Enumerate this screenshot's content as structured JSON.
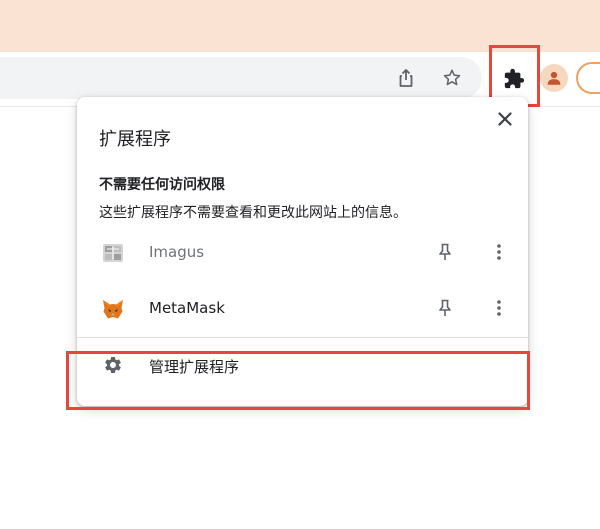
{
  "browser": {
    "toolbar": {
      "share_icon": "share-icon",
      "bookmark_icon": "star-icon",
      "extensions_icon": "puzzle-icon",
      "profile_icon": "person-icon"
    }
  },
  "extensions_popup": {
    "title": "扩展程序",
    "section_title": "不需要任何访问权限",
    "section_description": "这些扩展程序不需要查看和更改此网站上的信息。",
    "extensions": [
      {
        "name": "Imagus",
        "enabled": false
      },
      {
        "name": "MetaMask",
        "enabled": true
      }
    ],
    "manage_label": "管理扩展程序"
  },
  "colors": {
    "accent_highlight": "#e5463d",
    "top_band": "#fbe3d3",
    "metamask_orange": "#e2761b"
  }
}
